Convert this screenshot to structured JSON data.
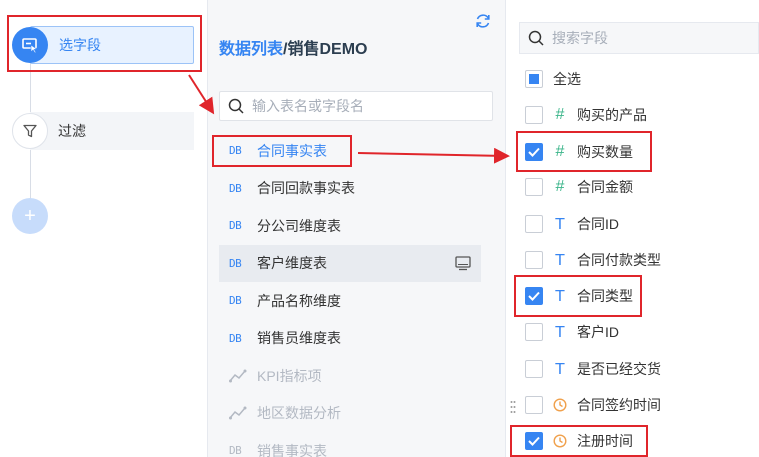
{
  "steps": {
    "select_label": "选字段",
    "filter_label": "过滤",
    "add_label": "+"
  },
  "middle": {
    "title_prefix": "数据列表",
    "title_suffix": "/销售DEMO",
    "search_placeholder": "输入表名或字段名",
    "tables": [
      {
        "label": "合同事实表",
        "icon": "DB",
        "state": "active"
      },
      {
        "label": "合同回款事实表",
        "icon": "DB",
        "state": "normal"
      },
      {
        "label": "分公司维度表",
        "icon": "DB",
        "state": "normal"
      },
      {
        "label": "客户维度表",
        "icon": "DB",
        "state": "hover"
      },
      {
        "label": "产品名称维度",
        "icon": "DB",
        "state": "normal"
      },
      {
        "label": "销售员维度表",
        "icon": "DB",
        "state": "normal"
      },
      {
        "label": "KPI指标项",
        "icon": "trend",
        "state": "disabled"
      },
      {
        "label": "地区数据分析",
        "icon": "trend",
        "state": "disabled"
      },
      {
        "label": "销售事实表",
        "icon": "DB",
        "state": "disabled"
      }
    ]
  },
  "right": {
    "search_placeholder": "搜索字段",
    "select_all_label": "全选",
    "fields": [
      {
        "label": "购买的产品",
        "type": "#",
        "checked": false
      },
      {
        "label": "购买数量",
        "type": "#",
        "checked": true
      },
      {
        "label": "合同金额",
        "type": "#",
        "checked": false
      },
      {
        "label": "合同ID",
        "type": "T",
        "checked": false
      },
      {
        "label": "合同付款类型",
        "type": "T",
        "checked": false
      },
      {
        "label": "合同类型",
        "type": "T",
        "checked": true
      },
      {
        "label": "客户ID",
        "type": "T",
        "checked": false
      },
      {
        "label": "是否已经交货",
        "type": "T",
        "checked": false
      },
      {
        "label": "合同签约时间",
        "type": "clock",
        "checked": false
      },
      {
        "label": "注册时间",
        "type": "clock",
        "checked": true
      }
    ]
  },
  "colors": {
    "accent": "#3685f2",
    "annotation": "#e0252b",
    "number_type": "#3bb58a",
    "date_type": "#f0a04b"
  }
}
